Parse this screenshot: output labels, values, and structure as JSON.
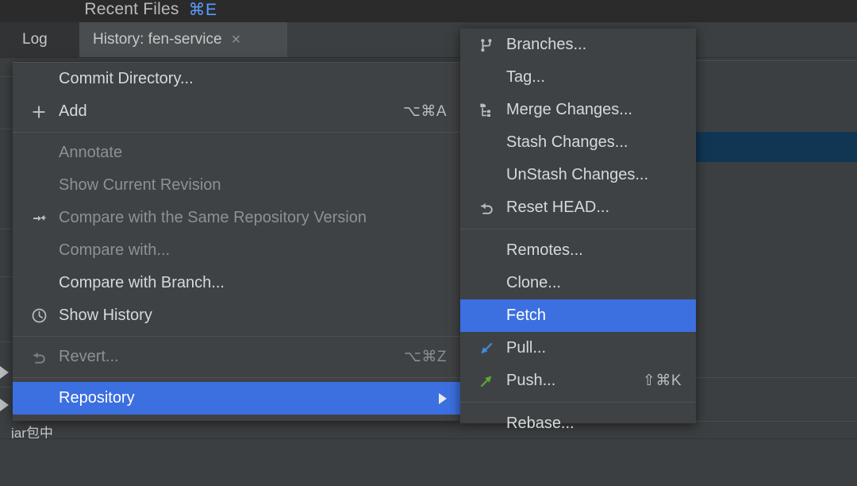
{
  "window": {
    "recent_files_label": "Recent Files",
    "recent_files_shortcut": "⌘E"
  },
  "tabs": [
    {
      "label": "Log",
      "active": false
    },
    {
      "label": "History: fen-service",
      "active": true,
      "close_glyph": "×"
    }
  ],
  "colors": {
    "menu_bg": "#3f4244",
    "panel_bg": "#3c3f41",
    "topbar_bg": "#2b2b2b",
    "selection_blue": "#3c6fe0",
    "row_selection_navy": "#113654",
    "accent_shortcut": "#5b9bf8",
    "text_primary": "#d6d9db",
    "text_disabled": "#8e9194",
    "pull_arrow": "#3d8ee0",
    "push_arrow": "#5aa832"
  },
  "context_menu": {
    "name": "vcs-context-menu",
    "items": [
      {
        "id": "commit-directory",
        "label": "Commit Directory...",
        "icon": null,
        "shortcut": "",
        "disabled": false,
        "selected": false
      },
      {
        "id": "add",
        "label": "Add",
        "icon": "plus-icon",
        "shortcut": "⌥⌘A",
        "disabled": false,
        "selected": false
      },
      {
        "id": "sep-1",
        "type": "separator"
      },
      {
        "id": "annotate",
        "label": "Annotate",
        "icon": null,
        "shortcut": "",
        "disabled": true,
        "selected": false
      },
      {
        "id": "show-current-revision",
        "label": "Show Current Revision",
        "icon": null,
        "shortcut": "",
        "disabled": true,
        "selected": false
      },
      {
        "id": "compare-same-repository-version",
        "label": "Compare with the Same Repository Version",
        "icon": "compare-icon",
        "shortcut": "",
        "disabled": true,
        "selected": false
      },
      {
        "id": "compare-with",
        "label": "Compare with...",
        "icon": null,
        "shortcut": "",
        "disabled": true,
        "selected": false
      },
      {
        "id": "compare-with-branch",
        "label": "Compare with Branch...",
        "icon": null,
        "shortcut": "",
        "disabled": false,
        "selected": false
      },
      {
        "id": "show-history",
        "label": "Show History",
        "icon": "clock-icon",
        "shortcut": "",
        "disabled": false,
        "selected": false
      },
      {
        "id": "sep-2",
        "type": "separator"
      },
      {
        "id": "revert",
        "label": "Revert...",
        "icon": "revert-icon",
        "shortcut": "⌥⌘Z",
        "disabled": true,
        "selected": false
      },
      {
        "id": "sep-3",
        "type": "separator"
      },
      {
        "id": "repository",
        "label": "Repository",
        "icon": null,
        "shortcut": "",
        "disabled": false,
        "selected": true,
        "has_submenu": true
      }
    ]
  },
  "submenu": {
    "name": "repository-submenu",
    "items": [
      {
        "id": "branches",
        "label": "Branches...",
        "icon": "branch-icon",
        "shortcut": "",
        "disabled": false,
        "selected": false
      },
      {
        "id": "tag",
        "label": "Tag...",
        "icon": null,
        "shortcut": "",
        "disabled": false,
        "selected": false
      },
      {
        "id": "merge-changes",
        "label": "Merge Changes...",
        "icon": "merge-icon",
        "shortcut": "",
        "disabled": false,
        "selected": false
      },
      {
        "id": "stash-changes",
        "label": "Stash Changes...",
        "icon": null,
        "shortcut": "",
        "disabled": false,
        "selected": false
      },
      {
        "id": "unstash-changes",
        "label": "UnStash Changes...",
        "icon": null,
        "shortcut": "",
        "disabled": false,
        "selected": false
      },
      {
        "id": "reset-head",
        "label": "Reset HEAD...",
        "icon": "reset-icon",
        "shortcut": "",
        "disabled": false,
        "selected": false
      },
      {
        "id": "sep-a",
        "type": "separator"
      },
      {
        "id": "remotes",
        "label": "Remotes...",
        "icon": null,
        "shortcut": "",
        "disabled": false,
        "selected": false
      },
      {
        "id": "clone",
        "label": "Clone...",
        "icon": null,
        "shortcut": "",
        "disabled": false,
        "selected": false
      },
      {
        "id": "fetch",
        "label": "Fetch",
        "icon": null,
        "shortcut": "",
        "disabled": false,
        "selected": true
      },
      {
        "id": "pull",
        "label": "Pull...",
        "icon": "pull-arrow-icon",
        "shortcut": "",
        "disabled": false,
        "selected": false
      },
      {
        "id": "push",
        "label": "Push...",
        "icon": "push-arrow-icon",
        "shortcut": "⇧⌘K",
        "disabled": false,
        "selected": false
      },
      {
        "id": "sep-b",
        "type": "separator"
      },
      {
        "id": "rebase",
        "label": "Rebase...",
        "icon": null,
        "shortcut": "",
        "disabled": false,
        "selected": false
      }
    ]
  },
  "status": {
    "message": "jar包中"
  }
}
